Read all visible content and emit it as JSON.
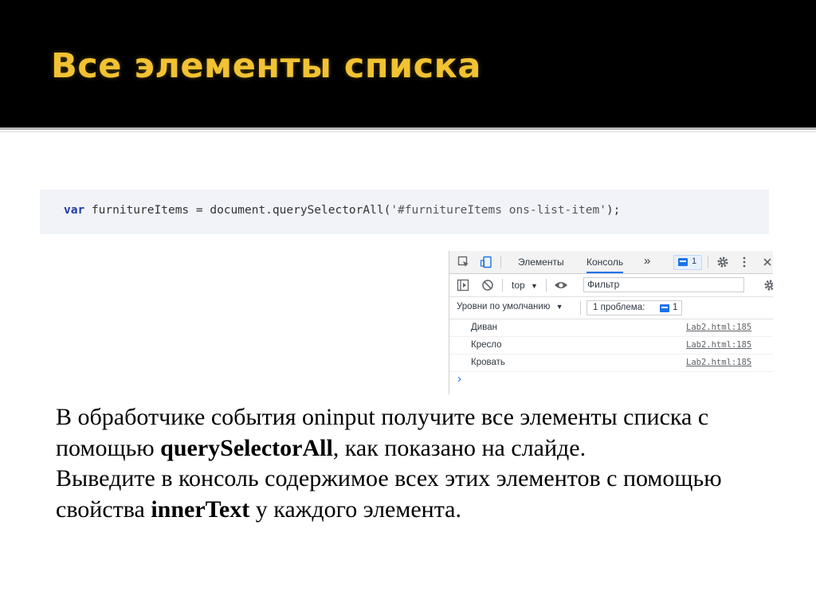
{
  "slide": {
    "title": "Все элементы списка",
    "colors": {
      "header_bg": "#000000",
      "title": "#f1c232"
    }
  },
  "code": {
    "keyword": "var",
    "rest": " furnitureItems = document.querySelectorAll(",
    "string": "'#furnitureItems ons-list-item'",
    "end": ");"
  },
  "devtools": {
    "tabs": [
      "Элементы",
      "Консоль"
    ],
    "active_tab": "Консоль",
    "more": "»",
    "issues_badge_count": "1",
    "context": "top",
    "filter_placeholder": "Фильтр",
    "levels_label": "Уровни по умолчанию",
    "issues_label": "1 проблема:",
    "issues_count": "1",
    "log": [
      {
        "text": "Диван",
        "source": "Lab2.html:185"
      },
      {
        "text": "Кресло",
        "source": "Lab2.html:185"
      },
      {
        "text": "Кровать",
        "source": "Lab2.html:185"
      }
    ],
    "prompt": "›",
    "icons": [
      "inspect-icon",
      "device-icon",
      "gear-icon",
      "kebab-icon",
      "close-icon",
      "sidebar-icon",
      "clear-icon",
      "eye-icon"
    ]
  },
  "body": {
    "p1_a": "В обработчике события oninput получите все элементы списка с помощью ",
    "p1_b": "querySelectorAll",
    "p1_c": ", как показано на слайде.",
    "p2_a": "Выведите в консоль содержимое всех этих элементов с помощью свойства ",
    "p2_b": "innerText",
    "p2_c": " у каждого элемента."
  }
}
